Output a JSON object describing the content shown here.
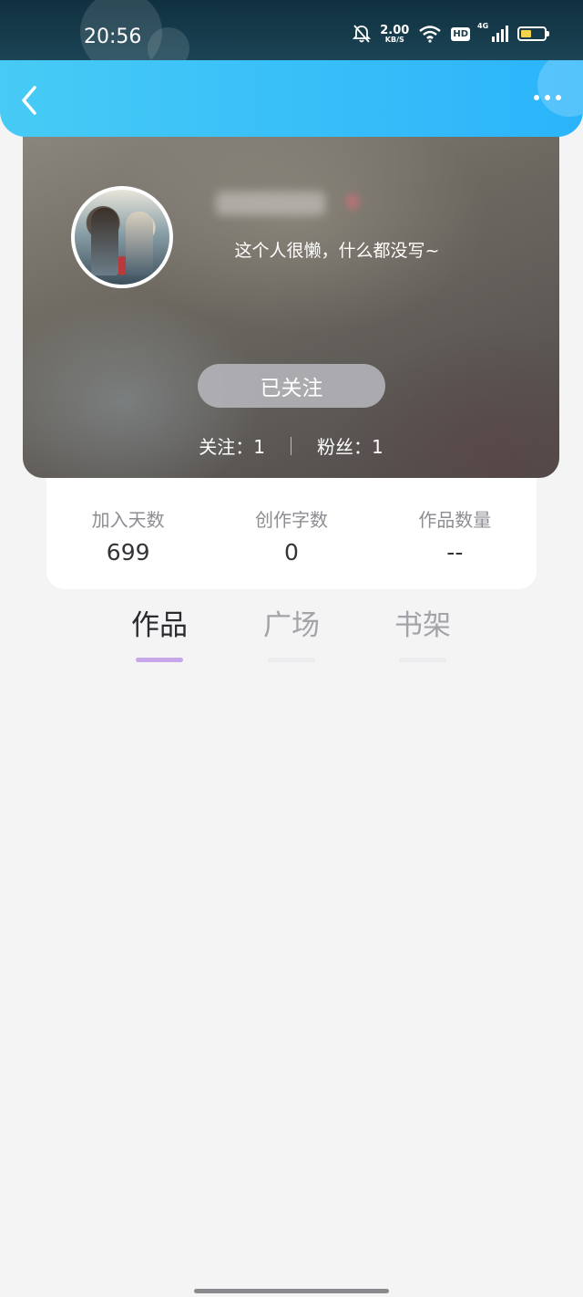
{
  "status_bar": {
    "time": "20:56",
    "net_speed_value": "2.00",
    "net_speed_unit": "KB/S",
    "hd_label": "HD",
    "signal_label": "4G",
    "battery_level": 0.45,
    "icons": [
      "bell-muted-icon",
      "wifi-icon",
      "hd-icon",
      "signal-icon",
      "battery-icon"
    ]
  },
  "nav": {
    "back_icon": "chevron-left-icon",
    "more_icon": "more-dots-icon"
  },
  "profile": {
    "bio": "这个人很懒，什么都没写~",
    "follow_button": "已关注",
    "following_label": "关注：1",
    "followers_label": "粉丝：1"
  },
  "stats": [
    {
      "label": "加入天数",
      "value": "699"
    },
    {
      "label": "创作字数",
      "value": "0"
    },
    {
      "label": "作品数量",
      "value": "--"
    }
  ],
  "tabs": [
    {
      "label": "作品",
      "active": true
    },
    {
      "label": "广场",
      "active": false
    },
    {
      "label": "书架",
      "active": false
    }
  ],
  "colors": {
    "nav_gradient_start": "#47cbf5",
    "nav_gradient_end": "#2bb4fb",
    "tab_indicator_active": "#c7a6ea",
    "page_background": "#f4f4f5"
  }
}
